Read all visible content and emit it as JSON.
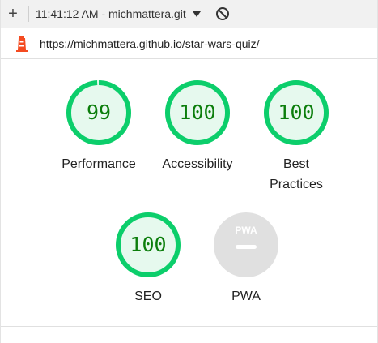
{
  "toolbar": {
    "new_label": "+",
    "report_title": "11:41:12 AM - michmattera.git",
    "icons": [
      "plus-icon",
      "dropdown-icon",
      "block-icon"
    ]
  },
  "urlbar": {
    "url": "https://michmattera.github.io/star-wars-quiz/",
    "icon": "lighthouse-icon"
  },
  "colors": {
    "pass_ring": "#0cce6b",
    "pass_fill": "#e6f9ee",
    "pass_text": "#0c7e0c",
    "pwa_gray": "#e0e0e0"
  },
  "categories": [
    {
      "id": "performance",
      "score": "99",
      "score_value": 99,
      "label_lines": [
        "Performance"
      ]
    },
    {
      "id": "accessibility",
      "score": "100",
      "score_value": 100,
      "label_lines": [
        "Accessibility"
      ]
    },
    {
      "id": "best-practices",
      "score": "100",
      "score_value": 100,
      "label_lines": [
        "Best",
        "Practices"
      ]
    },
    {
      "id": "seo",
      "score": "100",
      "score_value": 100,
      "label_lines": [
        "SEO"
      ]
    }
  ],
  "pwa": {
    "badge_text": "PWA",
    "label": "PWA"
  }
}
